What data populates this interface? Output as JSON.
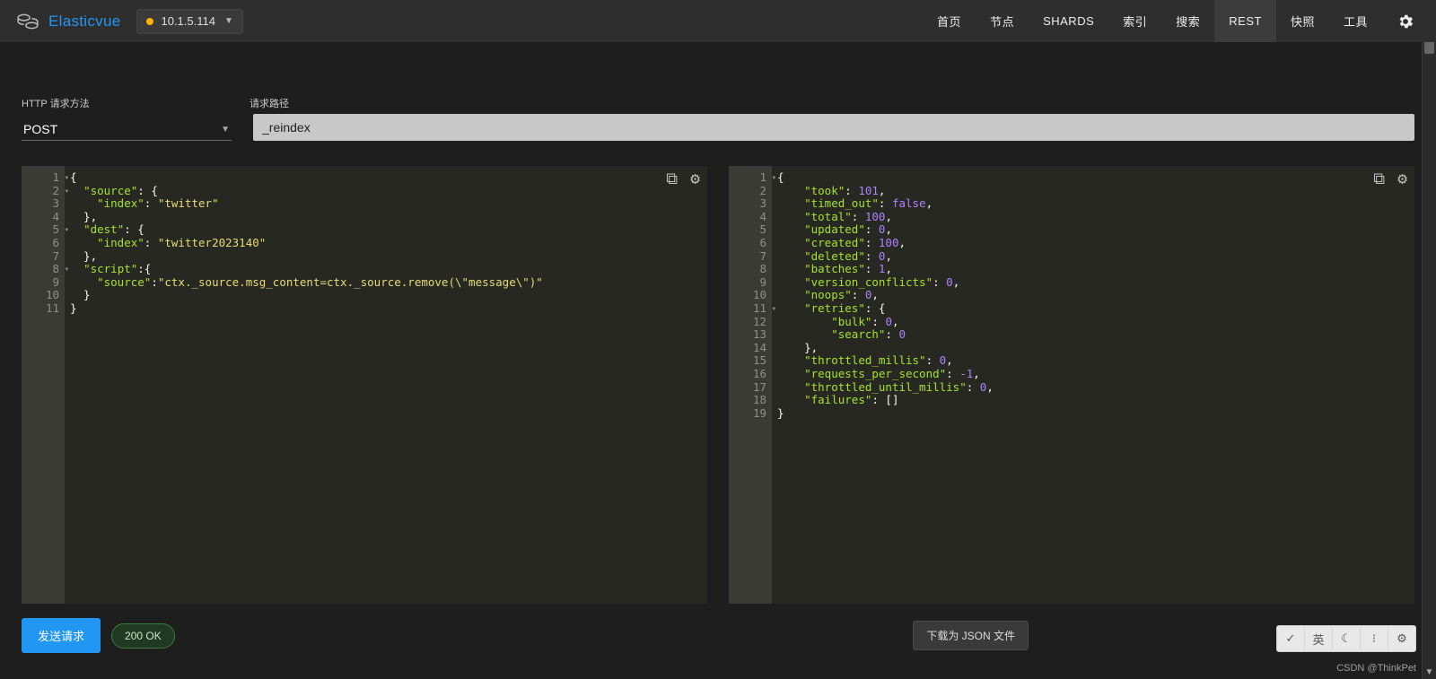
{
  "app": {
    "name": "Elasticvue"
  },
  "cluster": {
    "status_color": "#ffb300",
    "ip": "10.1.5.114"
  },
  "nav": {
    "items": [
      "首页",
      "节点",
      "SHARDS",
      "索引",
      "搜索",
      "REST",
      "快照",
      "工具"
    ],
    "active": 5
  },
  "http": {
    "method_label": "HTTP 请求方法",
    "method": "POST",
    "path_label": "请求路径",
    "path": "_reindex"
  },
  "request": {
    "lines": [
      {
        "n": 1,
        "fold": true,
        "seg": [
          [
            "p",
            "{"
          ]
        ]
      },
      {
        "n": 2,
        "fold": true,
        "seg": [
          [
            "p",
            "  "
          ],
          [
            "k",
            "\"source\""
          ],
          [
            "p",
            ": {"
          ]
        ]
      },
      {
        "n": 3,
        "seg": [
          [
            "p",
            "    "
          ],
          [
            "k",
            "\"index\""
          ],
          [
            "p",
            ": "
          ],
          [
            "s",
            "\"twitter\""
          ]
        ]
      },
      {
        "n": 4,
        "seg": [
          [
            "p",
            "  },"
          ]
        ]
      },
      {
        "n": 5,
        "fold": true,
        "seg": [
          [
            "p",
            "  "
          ],
          [
            "k",
            "\"dest\""
          ],
          [
            "p",
            ": {"
          ]
        ]
      },
      {
        "n": 6,
        "seg": [
          [
            "p",
            "    "
          ],
          [
            "k",
            "\"index\""
          ],
          [
            "p",
            ": "
          ],
          [
            "s",
            "\"twitter2023140\""
          ]
        ]
      },
      {
        "n": 7,
        "seg": [
          [
            "p",
            "  },"
          ]
        ]
      },
      {
        "n": 8,
        "fold": true,
        "seg": [
          [
            "p",
            "  "
          ],
          [
            "k",
            "\"script\""
          ],
          [
            "p",
            ":{"
          ]
        ]
      },
      {
        "n": 9,
        "seg": [
          [
            "p",
            "    "
          ],
          [
            "k",
            "\"source\""
          ],
          [
            "p",
            ":"
          ],
          [
            "s",
            "\"ctx._source.msg_content=ctx._source.remove(\\\"message\\\")\""
          ]
        ]
      },
      {
        "n": 10,
        "seg": [
          [
            "p",
            "  }"
          ]
        ]
      },
      {
        "n": 11,
        "hl": true,
        "seg": [
          [
            "p",
            "}"
          ]
        ]
      }
    ]
  },
  "response": {
    "lines": [
      {
        "n": 1,
        "fold": true,
        "seg": [
          [
            "p",
            "{"
          ]
        ]
      },
      {
        "n": 2,
        "seg": [
          [
            "p",
            "    "
          ],
          [
            "k",
            "\"took\""
          ],
          [
            "p",
            ": "
          ],
          [
            "n",
            "101"
          ],
          [
            "p",
            ","
          ]
        ]
      },
      {
        "n": 3,
        "seg": [
          [
            "p",
            "    "
          ],
          [
            "k",
            "\"timed_out\""
          ],
          [
            "p",
            ": "
          ],
          [
            "b",
            "false"
          ],
          [
            "p",
            ","
          ]
        ]
      },
      {
        "n": 4,
        "seg": [
          [
            "p",
            "    "
          ],
          [
            "k",
            "\"total\""
          ],
          [
            "p",
            ": "
          ],
          [
            "n",
            "100"
          ],
          [
            "p",
            ","
          ]
        ]
      },
      {
        "n": 5,
        "seg": [
          [
            "p",
            "    "
          ],
          [
            "k",
            "\"updated\""
          ],
          [
            "p",
            ": "
          ],
          [
            "n",
            "0"
          ],
          [
            "p",
            ","
          ]
        ]
      },
      {
        "n": 6,
        "seg": [
          [
            "p",
            "    "
          ],
          [
            "k",
            "\"created\""
          ],
          [
            "p",
            ": "
          ],
          [
            "n",
            "100"
          ],
          [
            "p",
            ","
          ]
        ]
      },
      {
        "n": 7,
        "seg": [
          [
            "p",
            "    "
          ],
          [
            "k",
            "\"deleted\""
          ],
          [
            "p",
            ": "
          ],
          [
            "n",
            "0"
          ],
          [
            "p",
            ","
          ]
        ]
      },
      {
        "n": 8,
        "seg": [
          [
            "p",
            "    "
          ],
          [
            "k",
            "\"batches\""
          ],
          [
            "p",
            ": "
          ],
          [
            "n",
            "1"
          ],
          [
            "p",
            ","
          ]
        ]
      },
      {
        "n": 9,
        "seg": [
          [
            "p",
            "    "
          ],
          [
            "k",
            "\"version_conflicts\""
          ],
          [
            "p",
            ": "
          ],
          [
            "n",
            "0"
          ],
          [
            "p",
            ","
          ]
        ]
      },
      {
        "n": 10,
        "seg": [
          [
            "p",
            "    "
          ],
          [
            "k",
            "\"noops\""
          ],
          [
            "p",
            ": "
          ],
          [
            "n",
            "0"
          ],
          [
            "p",
            ","
          ]
        ]
      },
      {
        "n": 11,
        "fold": true,
        "seg": [
          [
            "p",
            "    "
          ],
          [
            "k",
            "\"retries\""
          ],
          [
            "p",
            ": {"
          ]
        ]
      },
      {
        "n": 12,
        "seg": [
          [
            "p",
            "        "
          ],
          [
            "k",
            "\"bulk\""
          ],
          [
            "p",
            ": "
          ],
          [
            "n",
            "0"
          ],
          [
            "p",
            ","
          ]
        ]
      },
      {
        "n": 13,
        "seg": [
          [
            "p",
            "        "
          ],
          [
            "k",
            "\"search\""
          ],
          [
            "p",
            ": "
          ],
          [
            "n",
            "0"
          ]
        ]
      },
      {
        "n": 14,
        "seg": [
          [
            "p",
            "    },"
          ]
        ]
      },
      {
        "n": 15,
        "seg": [
          [
            "p",
            "    "
          ],
          [
            "k",
            "\"throttled_millis\""
          ],
          [
            "p",
            ": "
          ],
          [
            "n",
            "0"
          ],
          [
            "p",
            ","
          ]
        ]
      },
      {
        "n": 16,
        "seg": [
          [
            "p",
            "    "
          ],
          [
            "k",
            "\"requests_per_second\""
          ],
          [
            "p",
            ": "
          ],
          [
            "n",
            "-1"
          ],
          [
            "p",
            ","
          ]
        ]
      },
      {
        "n": 17,
        "seg": [
          [
            "p",
            "    "
          ],
          [
            "k",
            "\"throttled_until_millis\""
          ],
          [
            "p",
            ": "
          ],
          [
            "n",
            "0"
          ],
          [
            "p",
            ","
          ]
        ]
      },
      {
        "n": 18,
        "seg": [
          [
            "p",
            "    "
          ],
          [
            "k",
            "\"failures\""
          ],
          [
            "p",
            ": []"
          ]
        ]
      },
      {
        "n": 19,
        "hl": true,
        "seg": [
          [
            "p",
            "}"
          ]
        ]
      }
    ]
  },
  "buttons": {
    "send": "发送请求",
    "status": "200 OK",
    "download": "下载为 JSON 文件"
  },
  "ime_tools": [
    "✓",
    "英",
    "☾",
    "⁝",
    "⚙"
  ],
  "watermark": "CSDN @ThinkPet"
}
